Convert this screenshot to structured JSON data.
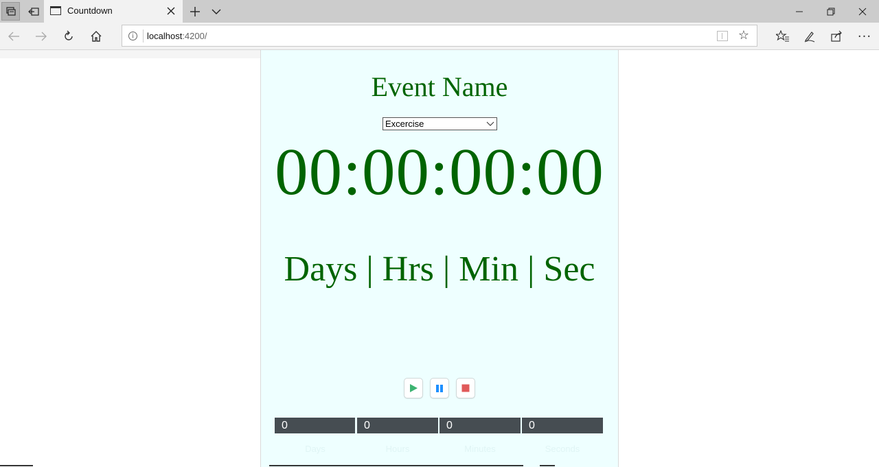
{
  "browser": {
    "tab_title": "Countdown",
    "url_host": "localhost",
    "url_port": ":4200/",
    "icons": {
      "tab_actions": "tab-actions-icon",
      "back_tabs": "set-aside-tabs-icon",
      "new_tab": "plus-icon",
      "tab_menu": "chevron-down-icon",
      "back": "arrow-left-icon",
      "forward": "arrow-right-icon",
      "refresh": "refresh-icon",
      "home": "home-icon",
      "info": "info-icon",
      "reading_view": "reading-view-icon",
      "favorite": "star-icon",
      "favorites_hub": "favorites-list-icon",
      "notes": "pen-icon",
      "share": "share-icon",
      "more": "more-icon"
    }
  },
  "page": {
    "event_name": "Event Name",
    "event_select_value": "Excercise",
    "countdown": "00:00:00:00",
    "unit_labels": "Days | Hrs | Min | Sec",
    "counters": [
      "0",
      "0",
      "0",
      "0"
    ],
    "captions": [
      "Days",
      "Hours",
      "Minutes",
      "Seconds"
    ],
    "colors": {
      "panel_bg": "#eeffff",
      "text_green": "#006400",
      "play": "#3cb371",
      "pause": "#1e90ff",
      "stop": "#e05a5a",
      "counter_bg": "#464d52"
    }
  }
}
